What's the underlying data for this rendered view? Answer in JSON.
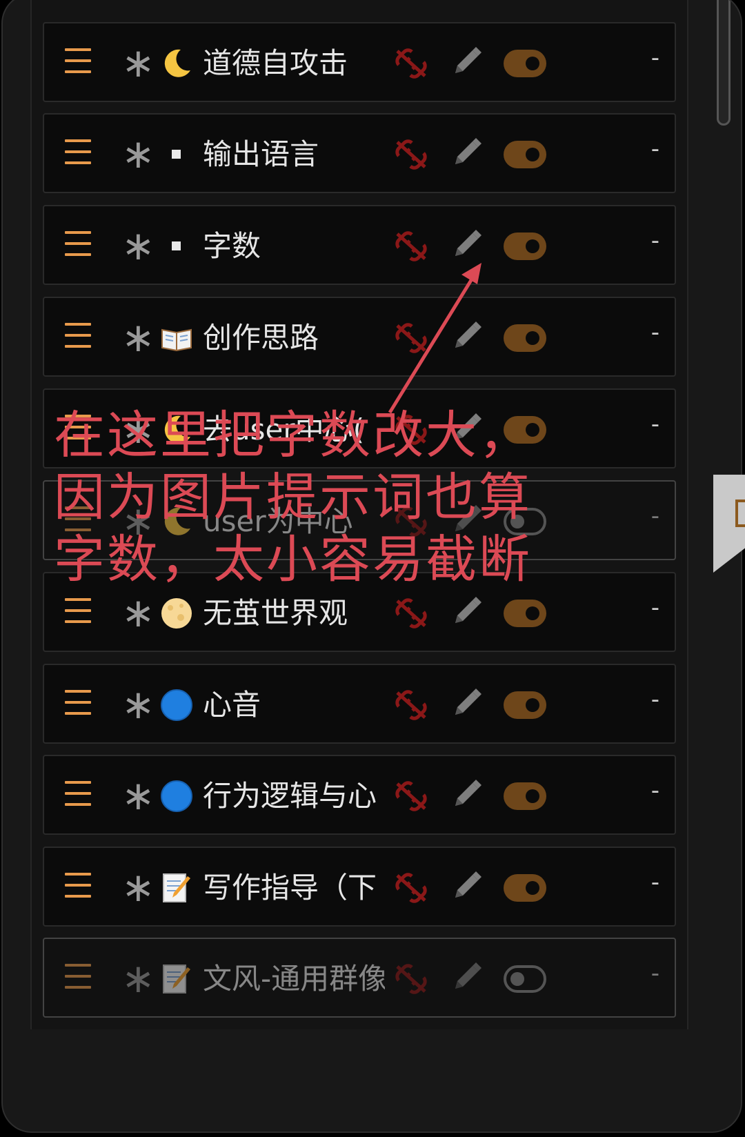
{
  "rows": [
    {
      "name": "道德自攻击",
      "emoji": "moon-icon",
      "enabled": true
    },
    {
      "name": "输出语言",
      "emoji": "small-square-icon",
      "enabled": true
    },
    {
      "name": "字数",
      "emoji": "small-square-icon",
      "enabled": true
    },
    {
      "name": "创作思路",
      "emoji": "open-book-icon",
      "enabled": true
    },
    {
      "name": "去user中心(",
      "emoji": "moon-icon",
      "enabled": true
    },
    {
      "name": "user为中心",
      "emoji": "moon-icon",
      "enabled": false
    },
    {
      "name": "无茧世界观",
      "emoji": "full-moon-icon",
      "enabled": true
    },
    {
      "name": "心音",
      "emoji": "blue-circle-icon",
      "enabled": true
    },
    {
      "name": "行为逻辑与心",
      "emoji": "blue-circle-icon",
      "enabled": true
    },
    {
      "name": "写作指导（下",
      "emoji": "memo-icon",
      "enabled": true
    },
    {
      "name": "文风-通用群像",
      "emoji": "memo-icon",
      "enabled": false
    }
  ],
  "dash": "-",
  "annotation": {
    "line1": "在这里把字数改大，",
    "line2": "因为图片提示词也算",
    "line3": "字数，太小容易截断"
  },
  "colors": {
    "accent_orange": "#e89a4c",
    "toggle_on": "#6e461a",
    "link_red": "#8b1818",
    "annotation_red": "#dc4a55"
  }
}
